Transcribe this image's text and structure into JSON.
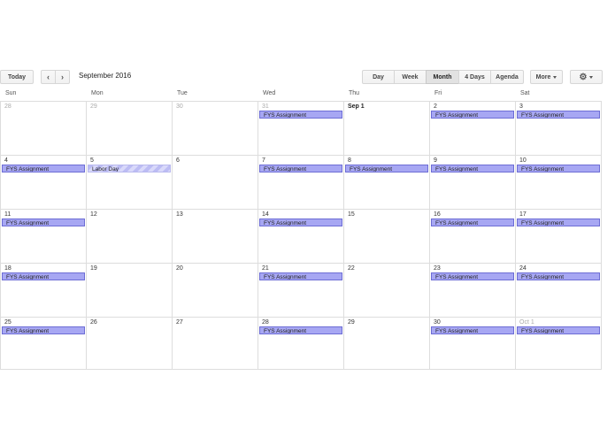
{
  "toolbar": {
    "today": "Today",
    "prev_icon": "chevron-left-icon",
    "next_icon": "chevron-right-icon",
    "prev_glyph": "‹",
    "next_glyph": "›",
    "title": "September 2016",
    "views": [
      "Day",
      "Week",
      "Month",
      "4 Days",
      "Agenda"
    ],
    "active_view": "Month",
    "more": "More",
    "settings_icon": "gear-icon",
    "settings_glyph": "⚙"
  },
  "weekdays": [
    "Sun",
    "Mon",
    "Tue",
    "Wed",
    "Thu",
    "Fri",
    "Sat"
  ],
  "weeks": [
    [
      {
        "d": "28",
        "dim": true
      },
      {
        "d": "29",
        "dim": true
      },
      {
        "d": "30",
        "dim": true
      },
      {
        "d": "31",
        "dim": true,
        "ev": "FYS Assignment"
      },
      {
        "d": "Sep 1",
        "bold": true
      },
      {
        "d": "2",
        "ev": "FYS Assignment"
      },
      {
        "d": "3",
        "ev": "FYS Assignment"
      }
    ],
    [
      {
        "d": "4",
        "ev": "FYS Assignment"
      },
      {
        "d": "5",
        "ev": "Labor Day",
        "holiday": true
      },
      {
        "d": "6"
      },
      {
        "d": "7",
        "ev": "FYS Assignment"
      },
      {
        "d": "8",
        "ev": "FYS Assignment"
      },
      {
        "d": "9",
        "ev": "FYS Assignment"
      },
      {
        "d": "10",
        "ev": "FYS Assignment"
      }
    ],
    [
      {
        "d": "11",
        "ev": "FYS Assignment"
      },
      {
        "d": "12"
      },
      {
        "d": "13"
      },
      {
        "d": "14",
        "ev": "FYS Assignment"
      },
      {
        "d": "15"
      },
      {
        "d": "16",
        "ev": "FYS Assignment"
      },
      {
        "d": "17",
        "ev": "FYS Assignment"
      }
    ],
    [
      {
        "d": "18",
        "ev": "FYS Assignment"
      },
      {
        "d": "19"
      },
      {
        "d": "20"
      },
      {
        "d": "21",
        "ev": "FYS Assignment"
      },
      {
        "d": "22"
      },
      {
        "d": "23",
        "ev": "FYS Assignment"
      },
      {
        "d": "24",
        "ev": "FYS Assignment"
      }
    ],
    [
      {
        "d": "25",
        "ev": "FYS Assignment"
      },
      {
        "d": "26"
      },
      {
        "d": "27"
      },
      {
        "d": "28",
        "ev": "FYS Assignment"
      },
      {
        "d": "29"
      },
      {
        "d": "30",
        "ev": "FYS Assignment"
      },
      {
        "d": "Oct 1",
        "dim": true,
        "ev": "FYS Assignment"
      }
    ]
  ],
  "colors": {
    "event_bg": "#a7a7f3",
    "event_border": "#6d6dd5",
    "grid": "#dddddd"
  }
}
